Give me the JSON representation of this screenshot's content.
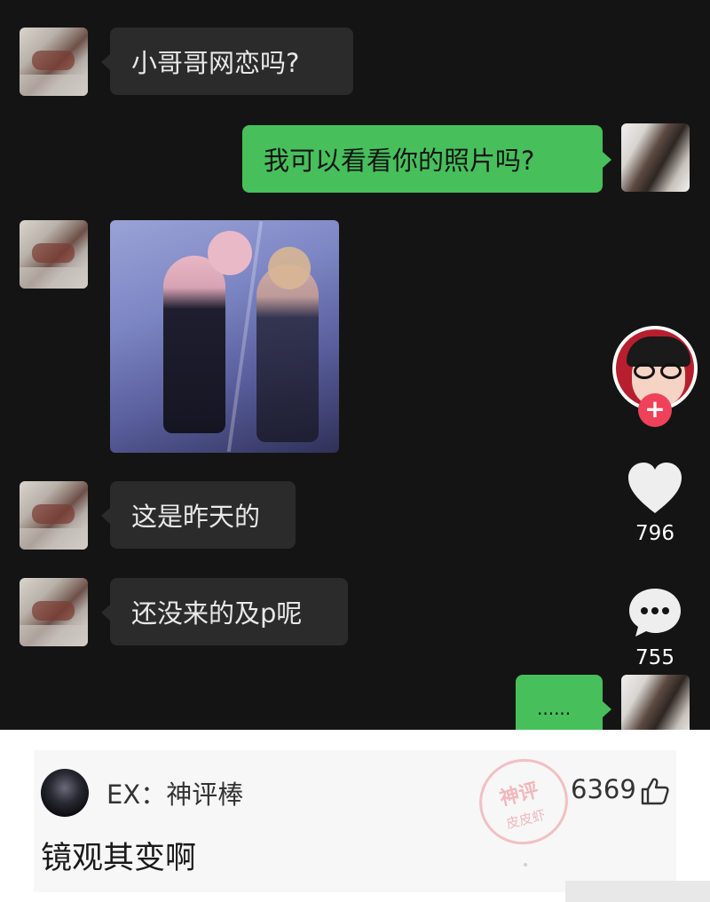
{
  "messages": [
    {
      "side": "in",
      "text": "小哥哥网恋吗?"
    },
    {
      "side": "out",
      "text": "我可以看看你的照片吗?"
    },
    {
      "side": "in",
      "type": "image"
    },
    {
      "side": "in",
      "text": "这是昨天的"
    },
    {
      "side": "in",
      "text": "还没来的及p呢"
    },
    {
      "side": "out",
      "text": "......"
    }
  ],
  "sidebar": {
    "likes": "796",
    "comments": "755",
    "follow_symbol": "+"
  },
  "comment_card": {
    "username": "EX：神评棒",
    "likes": "6369",
    "text": "镜观其变啊"
  },
  "watermark": {
    "line1": "神评",
    "line2": "皮皮虾"
  },
  "colors": {
    "chat_bg": "#141414",
    "incoming_bubble": "#2b2b2b",
    "outgoing_bubble": "#47c05c",
    "follow_button": "#f0415a"
  },
  "icons": [
    "heart-icon",
    "comment-icon",
    "thumbs-up-icon",
    "plus-icon"
  ]
}
